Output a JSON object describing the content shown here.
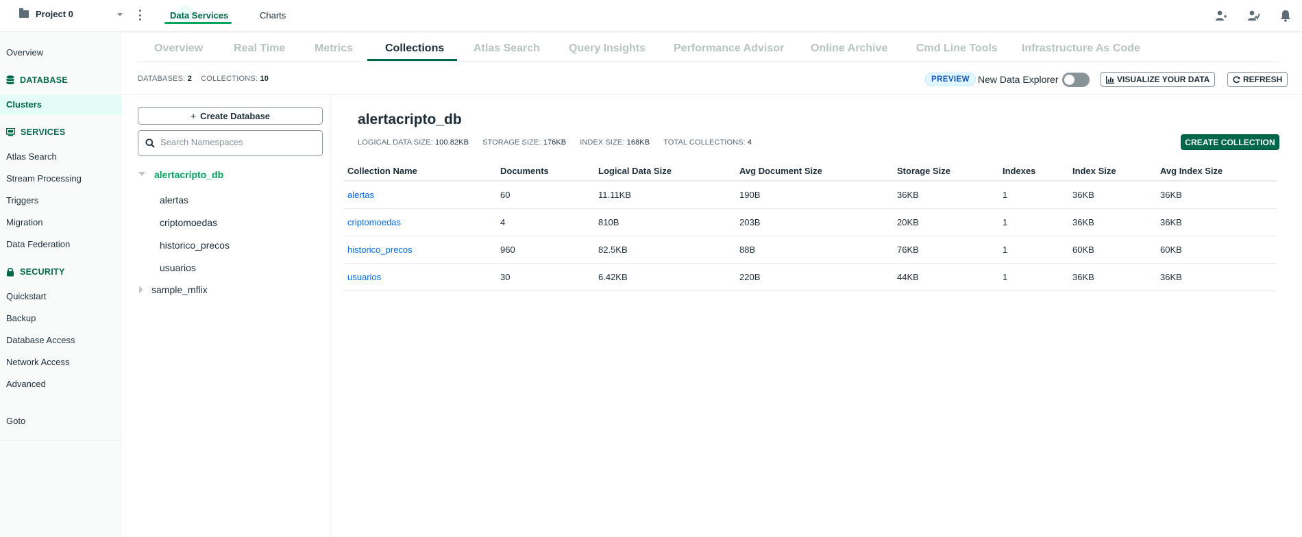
{
  "topbar": {
    "project": "Project 0",
    "tabs": [
      {
        "label": "Data Services"
      },
      {
        "label": "Charts"
      }
    ]
  },
  "sidebar": {
    "overview": "Overview",
    "database_heading": "DATABASE",
    "clusters": "Clusters",
    "services_heading": "SERVICES",
    "services_items": [
      "Atlas Search",
      "Stream Processing",
      "Triggers",
      "Migration",
      "Data Federation"
    ],
    "security_heading": "SECURITY",
    "security_items": [
      "Quickstart",
      "Backup",
      "Database Access",
      "Network Access",
      "Advanced"
    ],
    "goto": "Goto"
  },
  "subtabs": [
    "Overview",
    "Real Time",
    "Metrics",
    "Collections",
    "Atlas Search",
    "Query Insights",
    "Performance Advisor",
    "Online Archive",
    "Cmd Line Tools",
    "Infrastructure As Code"
  ],
  "counts": {
    "databases_label": "DATABASES:",
    "databases": "2",
    "collections_label": "COLLECTIONS:",
    "collections": "10"
  },
  "toolbar": {
    "preview": "PREVIEW",
    "new_explorer": "New Data Explorer",
    "visualize": "VISUALIZE YOUR DATA",
    "refresh": "REFRESH"
  },
  "namespaces": {
    "create_db": "Create Database",
    "search_placeholder": "Search Namespaces",
    "db1": "alertacripto_db",
    "db1_collections": [
      "alertas",
      "criptomoedas",
      "historico_precos",
      "usuarios"
    ],
    "db2": "sample_mflix"
  },
  "main": {
    "title": "alertacripto_db",
    "stats": {
      "logical_label": "LOGICAL DATA SIZE:",
      "logical": "100.82KB",
      "storage_label": "STORAGE SIZE:",
      "storage": "176KB",
      "index_label": "INDEX SIZE:",
      "index": "168KB",
      "total_label": "TOTAL COLLECTIONS:",
      "total": "4"
    },
    "create_collection": "CREATE COLLECTION",
    "columns": [
      "Collection Name",
      "Documents",
      "Logical Data Size",
      "Avg Document Size",
      "Storage Size",
      "Indexes",
      "Index Size",
      "Avg Index Size"
    ],
    "rows": [
      [
        "alertas",
        "60",
        "11.11KB",
        "190B",
        "36KB",
        "1",
        "36KB",
        "36KB"
      ],
      [
        "criptomoedas",
        "4",
        "810B",
        "203B",
        "20KB",
        "1",
        "36KB",
        "36KB"
      ],
      [
        "historico_precos",
        "960",
        "82.5KB",
        "88B",
        "76KB",
        "1",
        "60KB",
        "60KB"
      ],
      [
        "usuarios",
        "30",
        "6.42KB",
        "220B",
        "44KB",
        "1",
        "36KB",
        "36KB"
      ]
    ]
  },
  "colors": {
    "brand_green": "#00684a",
    "accent_green": "#00a35c",
    "link_blue": "#016bf8"
  },
  "icons": [
    "folder-icon",
    "chevron-down-icon",
    "kebab-menu-icon",
    "invite-user-icon",
    "activity-feed-icon",
    "bell-icon",
    "database-icon",
    "services-icon",
    "lock-icon",
    "plus-icon",
    "search-icon",
    "chart-icon",
    "refresh-icon"
  ]
}
